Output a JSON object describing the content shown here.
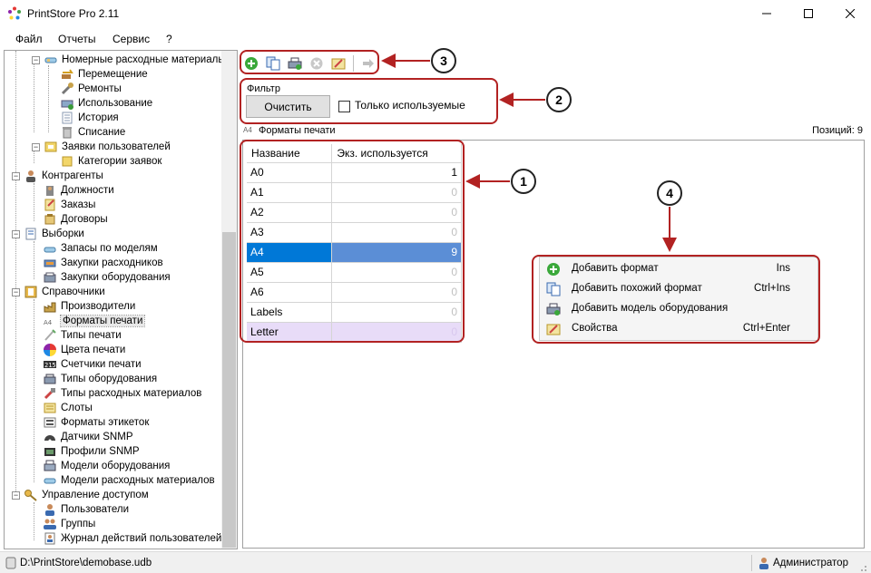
{
  "window": {
    "title": "PrintStore Pro 2.11"
  },
  "menu": [
    "Файл",
    "Отчеты",
    "Сервис",
    "?"
  ],
  "tree": [
    {
      "label": "Номерные расходные материалы",
      "icon": "consumable-icon"
    },
    {
      "label": "Перемещение",
      "icon": "move-icon"
    },
    {
      "label": "Ремонты",
      "icon": "repair-icon"
    },
    {
      "label": "Использование",
      "icon": "usage-icon"
    },
    {
      "label": "История",
      "icon": "history-icon"
    },
    {
      "label": "Списание",
      "icon": "writeoff-icon"
    },
    {
      "label": "Заявки пользователей",
      "icon": "requests-icon"
    },
    {
      "label": "Категории заявок",
      "icon": "request-category-icon"
    },
    {
      "label": "Контрагенты",
      "icon": "contractors-icon"
    },
    {
      "label": "Должности",
      "icon": "position-icon"
    },
    {
      "label": "Заказы",
      "icon": "orders-icon"
    },
    {
      "label": "Договоры",
      "icon": "contracts-icon"
    },
    {
      "label": "Выборки",
      "icon": "selections-icon"
    },
    {
      "label": "Запасы по моделям",
      "icon": "stock-icon"
    },
    {
      "label": "Закупки расходников",
      "icon": "purchase-consumables-icon"
    },
    {
      "label": "Закупки оборудования",
      "icon": "purchase-equipment-icon"
    },
    {
      "label": "Справочники",
      "icon": "reference-icon"
    },
    {
      "label": "Производители",
      "icon": "manufacturer-icon"
    },
    {
      "label": "Форматы печати",
      "icon": "print-format-icon"
    },
    {
      "label": "Типы печати",
      "icon": "print-type-icon"
    },
    {
      "label": "Цвета печати",
      "icon": "print-color-icon"
    },
    {
      "label": "Счетчики печати",
      "icon": "counter-icon"
    },
    {
      "label": "Типы оборудования",
      "icon": "equipment-type-icon"
    },
    {
      "label": "Типы расходных материалов",
      "icon": "consumable-type-icon"
    },
    {
      "label": "Слоты",
      "icon": "slots-icon"
    },
    {
      "label": "Форматы этикеток",
      "icon": "label-format-icon"
    },
    {
      "label": "Датчики SNMP",
      "icon": "snmp-sensor-icon"
    },
    {
      "label": "Профили SNMP",
      "icon": "snmp-profile-icon"
    },
    {
      "label": "Модели оборудования",
      "icon": "equipment-model-icon"
    },
    {
      "label": "Модели расходных материалов",
      "icon": "consumable-model-icon"
    },
    {
      "label": "Управление доступом",
      "icon": "access-key-icon"
    },
    {
      "label": "Пользователи",
      "icon": "users-icon"
    },
    {
      "label": "Группы",
      "icon": "groups-icon"
    },
    {
      "label": "Журнал действий пользователей",
      "icon": "user-log-icon"
    }
  ],
  "filter": {
    "label": "Фильтр",
    "clear_label": "Очистить",
    "only_used_label": "Только используемые",
    "only_used_checked": false
  },
  "section": {
    "title": "Форматы печати",
    "count_text": "Позиций: 9"
  },
  "grid": {
    "columns": [
      "Название",
      "Экз. используется"
    ],
    "rows": [
      {
        "name": "A0",
        "used": "1"
      },
      {
        "name": "A1",
        "used": "0"
      },
      {
        "name": "A2",
        "used": "0"
      },
      {
        "name": "A3",
        "used": "0"
      },
      {
        "name": "A4",
        "used": "9"
      },
      {
        "name": "A5",
        "used": "0"
      },
      {
        "name": "A6",
        "used": "0"
      },
      {
        "name": "Labels",
        "used": "0"
      },
      {
        "name": "Letter",
        "used": "0"
      }
    ]
  },
  "context_menu": [
    {
      "label": "Добавить формат",
      "shortcut": "Ins",
      "icon": "add-icon"
    },
    {
      "label": "Добавить похожий формат",
      "shortcut": "Ctrl+Ins",
      "icon": "copy-icon"
    },
    {
      "label": "Добавить модель оборудования",
      "shortcut": "",
      "icon": "printer-icon"
    },
    {
      "label": "Свойства",
      "shortcut": "Ctrl+Enter",
      "icon": "properties-icon"
    }
  ],
  "callouts": [
    "1",
    "2",
    "3",
    "4"
  ],
  "status": {
    "path": "D:\\PrintStore\\demobase.udb",
    "user": "Администратор"
  },
  "colors": {
    "selection": "#0078d7",
    "selection_light": "#5b8ed6",
    "lilac_row": "#e8dcf8",
    "annotation": "#b22222"
  }
}
